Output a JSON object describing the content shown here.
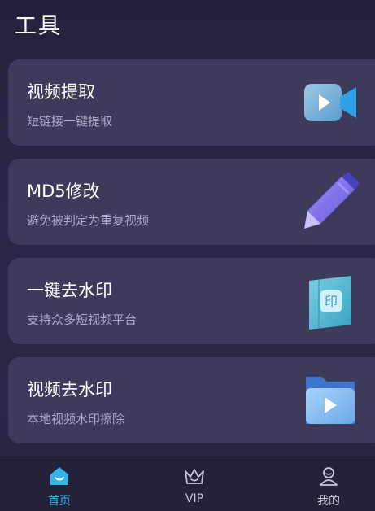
{
  "header": {
    "title": "工具"
  },
  "cards": [
    {
      "title": "视频提取",
      "subtitle": "短链接一键提取",
      "icon": "video-camera-icon"
    },
    {
      "title": "MD5修改",
      "subtitle": "避免被判定为重复视频",
      "icon": "pencil-icon"
    },
    {
      "title": "一键去水印",
      "subtitle": "支持众多短视频平台",
      "icon": "stamp-map-icon"
    },
    {
      "title": "视频去水印",
      "subtitle": "本地视频水印擦除",
      "icon": "video-folder-icon"
    }
  ],
  "bottom_nav": {
    "items": [
      {
        "label": "首页",
        "icon": "home-icon",
        "active": true
      },
      {
        "label": "VIP",
        "icon": "crown-icon",
        "active": false
      },
      {
        "label": "我的",
        "icon": "user-icon",
        "active": false
      }
    ]
  },
  "colors": {
    "accent": "#33b5e9",
    "card_bg": "#3d3a5b",
    "page_bg": "#272442"
  }
}
